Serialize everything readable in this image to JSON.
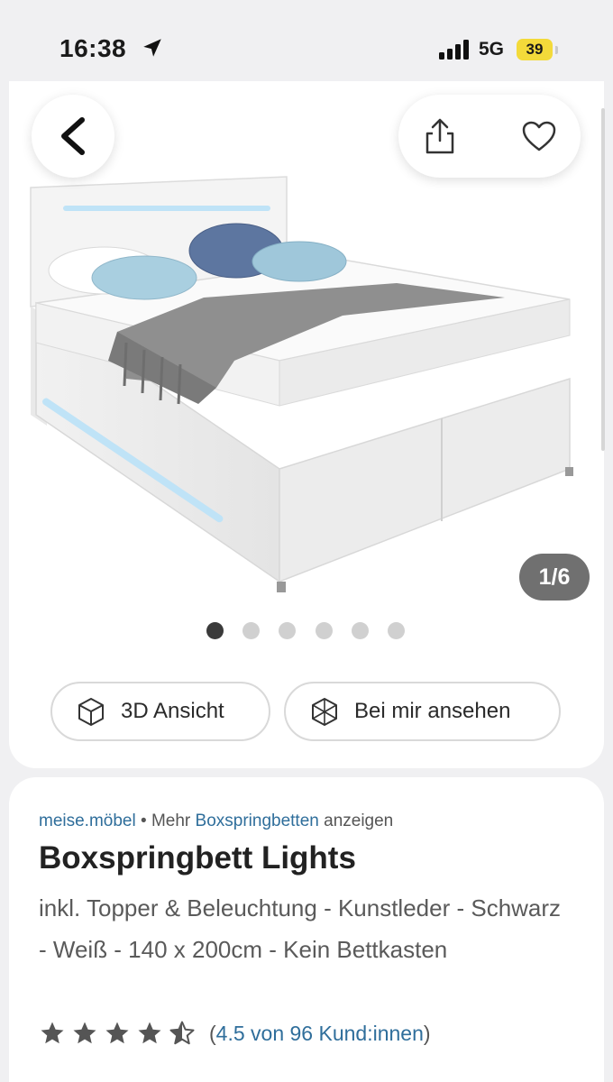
{
  "status_bar": {
    "time": "16:38",
    "network": "5G",
    "battery": "39"
  },
  "gallery": {
    "counter": "1/6",
    "dot_count": 6,
    "active_dot": 0
  },
  "actions": {
    "view_3d": "3D Ansicht",
    "view_ar": "Bei mir ansehen"
  },
  "product": {
    "brand": "meise.möbel",
    "separator": "•",
    "more_prefix": "Mehr",
    "category": "Boxspringbetten",
    "more_suffix": "anzeigen",
    "title": "Boxspringbett Lights",
    "description": "inkl. Topper & Beleuchtung - Kunstleder - Schwarz - Weiß - 140 x 200cm - Kein Bettkasten",
    "rating": {
      "value": 4.5,
      "max": 5,
      "open": "(",
      "label": "4.5 von 96 Kund:innen",
      "close": ")"
    }
  },
  "colors": {
    "link": "#2f6e9b",
    "battery": "#f3da3a",
    "star": "#555555"
  },
  "icons": [
    "back-arrow-icon",
    "share-icon",
    "heart-icon",
    "cube-icon",
    "ar-cube-icon",
    "star-icon",
    "half-star-icon",
    "location-arrow-icon",
    "signal-icon"
  ]
}
